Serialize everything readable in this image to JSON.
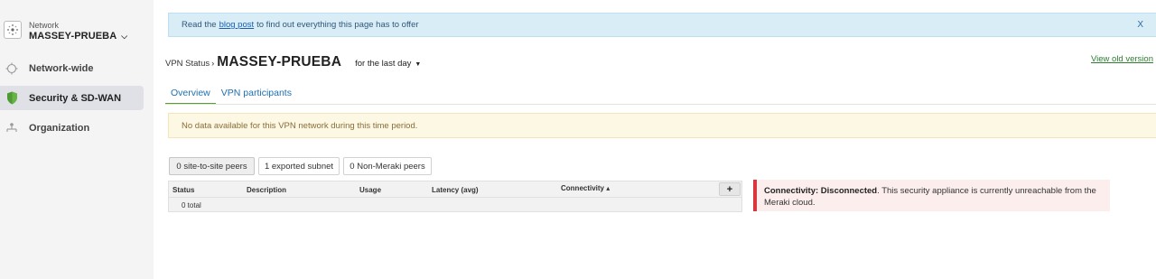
{
  "sidebar": {
    "network_caption": "Network",
    "network_name": "MASSEY-PRUEBA",
    "items": [
      {
        "label": "Network-wide",
        "icon": "network-wide-icon",
        "active": false
      },
      {
        "label": "Security & SD-WAN",
        "icon": "shield-icon",
        "active": true
      },
      {
        "label": "Organization",
        "icon": "organization-icon",
        "active": false
      }
    ]
  },
  "banner": {
    "text_before": "Read the",
    "link": "blog post",
    "text_after": "to find out everything this page has to offer",
    "close": "X"
  },
  "header": {
    "crumb": "VPN Status",
    "separator": "›",
    "title": "MASSEY-PRUEBA",
    "period": "for the last day",
    "old_version": "View old version"
  },
  "tabs": [
    {
      "label": "Overview",
      "active": true
    },
    {
      "label": "VPN participants",
      "active": false
    }
  ],
  "warning": "No data available for this VPN network during this time period.",
  "filters": [
    {
      "label": "0 site-to-site peers",
      "active": true
    },
    {
      "label": "1 exported subnet",
      "active": false
    },
    {
      "label": "0 Non-Meraki peers",
      "active": false
    }
  ],
  "table": {
    "columns": [
      "Status",
      "Description",
      "Usage",
      "Latency (avg)",
      "Connectivity"
    ],
    "sort_indicator": "▴",
    "add_label": "+",
    "total": "0 total"
  },
  "alert": {
    "bold": "Connectivity: Disconnected",
    "text": ". This security appliance is currently unreachable from the Meraki cloud."
  },
  "colors": {
    "sidebar_bg": "#f4f4f5",
    "active_nav_bg": "#dfe1e6",
    "shield_green": "#67b346",
    "tab_active_underline": "#5aa02c",
    "link_blue": "#1f6fb0",
    "old_version_green": "#2e7d32",
    "banner_bg": "#d9edf7",
    "warning_bg": "#fcf8e3",
    "alert_bar": "#d9363e",
    "alert_bg": "#fdeeee"
  }
}
